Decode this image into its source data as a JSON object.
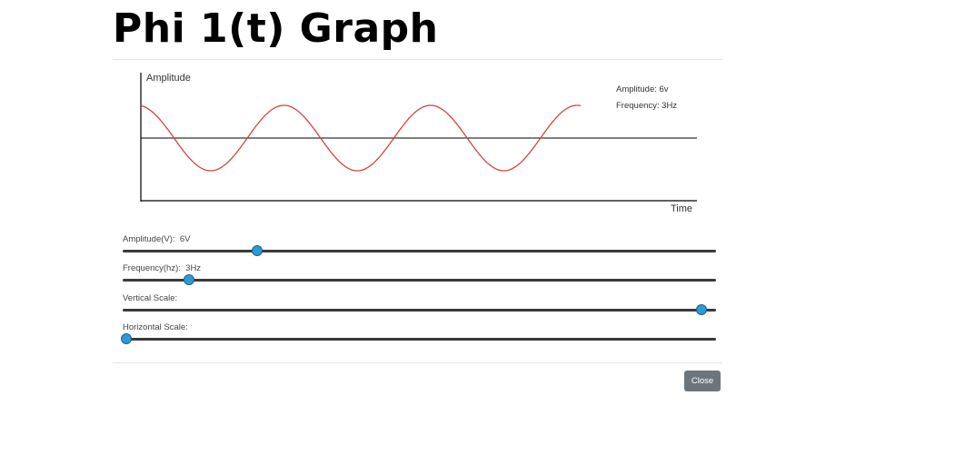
{
  "page": {
    "title": "Phi 1(t) Graph"
  },
  "graph": {
    "y_axis_label": "Amplitude",
    "x_axis_label": "Time",
    "info_amplitude": "Amplitude: 6v",
    "info_frequency": "Frequency: 3Hz",
    "wave_color": "#d9423c",
    "axis_color": "#000000"
  },
  "sliders": [
    {
      "label": "Amplitude(V):  6V",
      "level": 0.22
    },
    {
      "label": "Frequency(hz):  3Hz",
      "level": 0.105
    },
    {
      "label": "Vertical Scale:",
      "level": 0.97
    },
    {
      "label": "Horizontal Scale:",
      "level": 0.0
    }
  ],
  "footer": {
    "close_label": "Close"
  },
  "colors": {
    "slider_thumb": "#2b9bd8",
    "slider_track": "#3a3a3a",
    "close_button": "#6c757d"
  }
}
